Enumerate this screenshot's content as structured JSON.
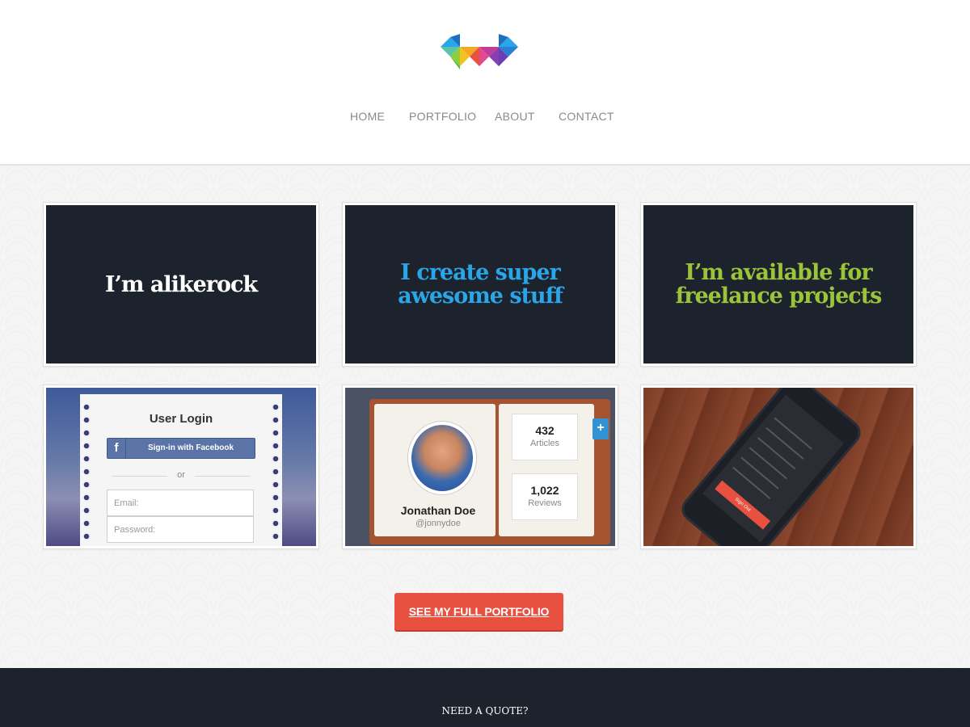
{
  "nav": {
    "items": [
      "HOME",
      "PORTFOLIO",
      "ABOUT",
      "CONTACT"
    ]
  },
  "tiles": {
    "t1": {
      "text": "I’m alikerock",
      "color": "#ffffff"
    },
    "t2": {
      "text": "I create super awesome stuff",
      "color": "#2aa6e8"
    },
    "t3": {
      "text": "I’m available for freelance projects",
      "color": "#9bc43a"
    }
  },
  "login": {
    "title": "User Login",
    "facebook_label": "Sign-in with Facebook",
    "facebook_icon": "f",
    "or_label": "or",
    "email_placeholder": "Email:",
    "password_placeholder": "Password:"
  },
  "profile": {
    "name": "Jonathan Doe",
    "handle": "@jonnydoe",
    "stats": [
      {
        "value": "432",
        "label": "Articles"
      },
      {
        "value": "1,022",
        "label": "Reviews"
      }
    ],
    "plus_icon": "+"
  },
  "phone": {
    "button_label": "Sign Out"
  },
  "cta": {
    "label": "SEE MY FULL PORTFOLIO"
  },
  "footer": {
    "quote_label": "NEED A QUOTE?"
  },
  "colors": {
    "accent": "#e8503f",
    "dark": "#1d232c",
    "blue": "#2aa6e8",
    "green": "#9bc43a"
  }
}
